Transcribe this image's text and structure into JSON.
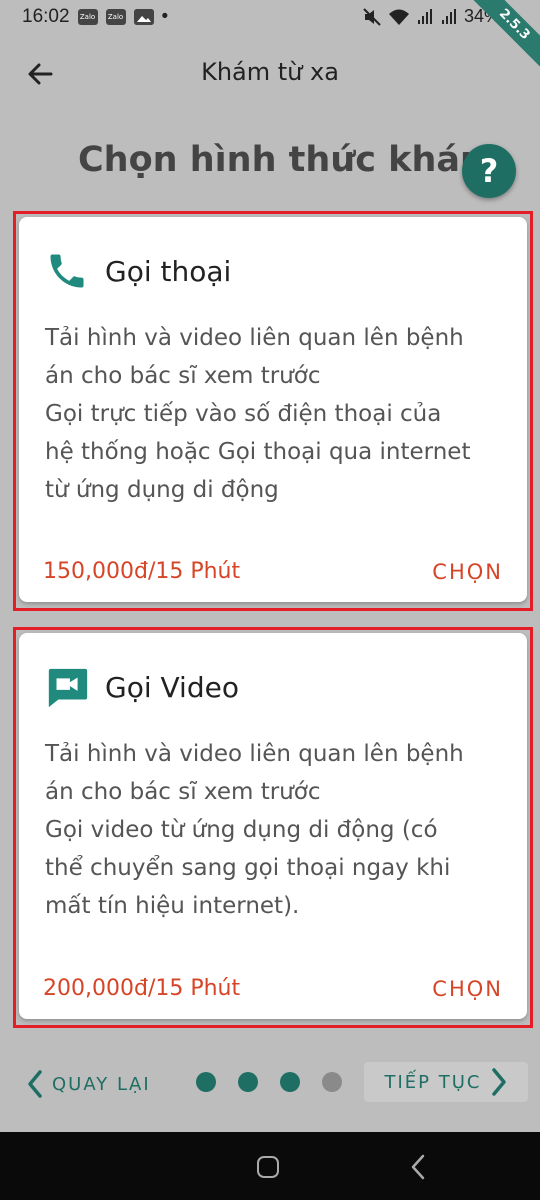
{
  "status_bar": {
    "time": "16:02",
    "notif_icons": [
      "zalo-icon",
      "zalo-icon",
      "image-icon"
    ],
    "notif_labels": [
      "Zalo",
      "Zalo"
    ],
    "dot": "•",
    "battery": "34%",
    "version": "2.5.3"
  },
  "app_bar": {
    "title": "Khám từ xa"
  },
  "page": {
    "heading": "Chọn hình thức khám",
    "help": "?"
  },
  "cards": [
    {
      "icon": "phone-icon",
      "title": "Gọi thoại",
      "description": [
        "Tải hình và video liên quan lên bệnh",
        "án cho bác sĩ xem trước",
        "Gọi trực tiếp vào số điện thoại của",
        "hệ thống hoặc Gọi thoại qua internet",
        "từ ứng dụng di động"
      ],
      "price": "150,000đ/15 Phút",
      "choose_label": "CHỌN"
    },
    {
      "icon": "video-chat-icon",
      "title": "Gọi Video",
      "description": [
        "Tải hình và video liên quan lên bệnh",
        "án cho bác sĩ xem trước",
        "Gọi video từ ứng dụng di động (có",
        "thể chuyển sang gọi thoại ngay khi",
        "mất tín hiệu internet)."
      ],
      "price": "200,000đ/15 Phút",
      "choose_label": "CHỌN"
    }
  ],
  "bottom_nav": {
    "back_label": "QUAY LẠI",
    "next_label": "TIẾP TỤC",
    "step_current": 3,
    "step_total": 4
  },
  "colors": {
    "accent": "#1f6e64",
    "price": "#d64527",
    "highlight_border": "#e41e26"
  }
}
